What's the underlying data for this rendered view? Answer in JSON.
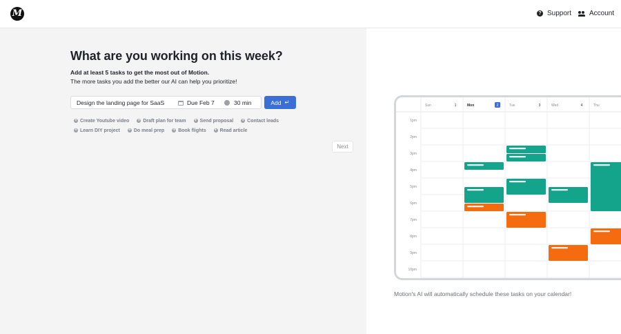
{
  "header": {
    "logo_text": "M",
    "support_label": "Support",
    "account_label": "Account"
  },
  "main": {
    "title": "What are you working on this week?",
    "subtitle": "Add at least 5 tasks to get the most out of Motion.",
    "subtext": "The more tasks you add the better our AI can help you prioritize!",
    "task_input_value": "Design the landing page for SaaS",
    "due_label": "Due Feb 7",
    "duration_label": "30 min",
    "add_label": "Add",
    "add_icon": "↵",
    "suggestions": [
      [
        "Create Youtube video",
        "Draft plan for team",
        "Send proposal",
        "Contact leads"
      ],
      [
        "Learn DIY project",
        "Do meal prep",
        "Book flights",
        "Read article"
      ]
    ],
    "next_label": "Next"
  },
  "calendar": {
    "days": [
      {
        "name": "Sun",
        "date": "1",
        "selected": false
      },
      {
        "name": "Mon",
        "date": "2",
        "selected": true
      },
      {
        "name": "Tue",
        "date": "3",
        "selected": false
      },
      {
        "name": "Wed",
        "date": "4",
        "selected": false
      },
      {
        "name": "Thu",
        "date": "",
        "selected": false
      }
    ],
    "hours": [
      "1pm",
      "2pm",
      "3pm",
      "4pm",
      "5pm",
      "6pm",
      "7pm",
      "8pm",
      "9pm",
      "10pm"
    ],
    "colors": {
      "teal": "#14a38b",
      "orange": "#f56b0f",
      "accent": "#3b6fd6"
    },
    "events": [
      {
        "day": 1,
        "start": 4.0,
        "end": 4.5,
        "color": "teal"
      },
      {
        "day": 1,
        "start": 5.5,
        "end": 6.5,
        "color": "teal"
      },
      {
        "day": 1,
        "start": 6.5,
        "end": 7.0,
        "color": "orange"
      },
      {
        "day": 2,
        "start": 3.0,
        "end": 3.5,
        "color": "teal"
      },
      {
        "day": 2,
        "start": 3.5,
        "end": 4.0,
        "color": "teal"
      },
      {
        "day": 2,
        "start": 5.0,
        "end": 6.0,
        "color": "teal"
      },
      {
        "day": 2,
        "start": 7.0,
        "end": 8.0,
        "color": "orange"
      },
      {
        "day": 3,
        "start": 5.5,
        "end": 6.5,
        "color": "teal"
      },
      {
        "day": 3,
        "start": 9.0,
        "end": 10.0,
        "color": "orange"
      },
      {
        "day": 4,
        "start": 4.0,
        "end": 7.0,
        "color": "teal"
      },
      {
        "day": 4,
        "start": 8.0,
        "end": 9.0,
        "color": "orange"
      }
    ]
  },
  "caption": "Motion's AI will automatically schedule these tasks on your calendar!"
}
